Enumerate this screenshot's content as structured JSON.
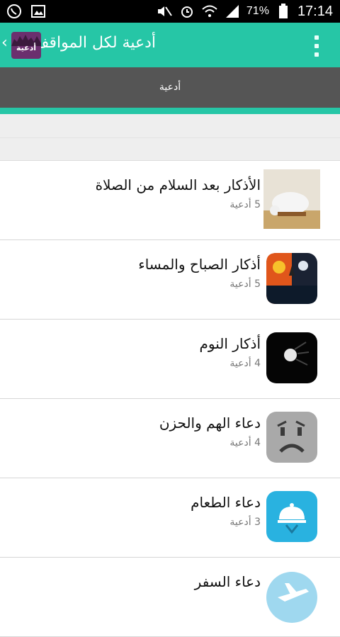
{
  "status_bar": {
    "battery_percent": "71%",
    "time": "17:14",
    "icons": [
      "whatsapp-icon",
      "gallery-icon",
      "mute-icon",
      "alarm-icon",
      "wifi-icon",
      "signal-icon",
      "battery-icon"
    ]
  },
  "app_bar": {
    "title": "أدعية لكل المواقف",
    "logo_text": "أدعية",
    "accent_color": "#26c6a6"
  },
  "tabs": [
    {
      "label": "أدعية"
    }
  ],
  "list": [
    {
      "title": "الأذكار بعد السلام من الصلاة",
      "count": "5 أدعية",
      "icon": "prayer-image"
    },
    {
      "title": "أذكار الصباح والمساء",
      "count": "5 أدعية",
      "icon": "day-night-icon"
    },
    {
      "title": "أذكار النوم",
      "count": "4 أدعية",
      "icon": "moon-night-icon"
    },
    {
      "title": "دعاء الهم والحزن",
      "count": "4 أدعية",
      "icon": "sad-face-icon"
    },
    {
      "title": "دعاء  الطعام",
      "count": "3 أدعية",
      "icon": "food-cloche-icon"
    },
    {
      "title": "دعاء السفر",
      "count": "",
      "icon": "airplane-icon"
    }
  ]
}
